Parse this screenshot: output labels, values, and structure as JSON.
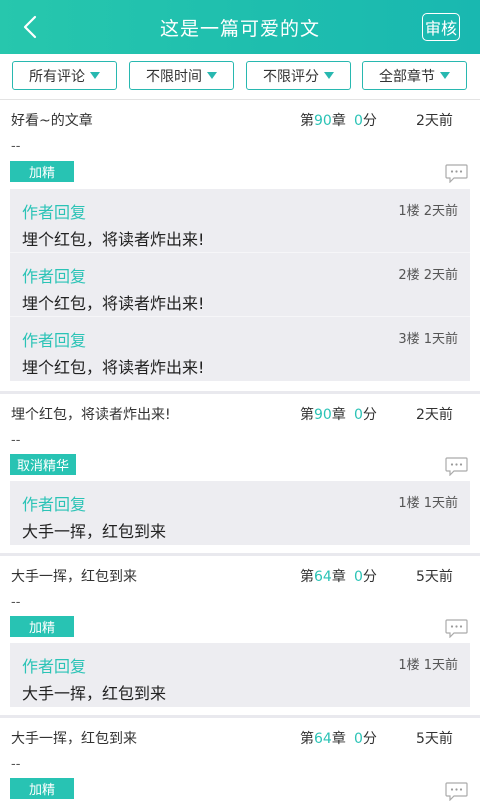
{
  "header": {
    "title": "这是一篇可爱的文",
    "audit_label": "审核"
  },
  "filters": [
    {
      "label": "所有评论"
    },
    {
      "label": "不限时间"
    },
    {
      "label": "不限评分"
    },
    {
      "label": "全部章节"
    }
  ],
  "comments": [
    {
      "text": "好看~的文章",
      "chapter_prefix": "第",
      "chapter": "90",
      "chapter_suffix": "章",
      "score": "0",
      "score_unit": "分",
      "time": "2天前",
      "dash": "--",
      "tag": "加精",
      "replies": [
        {
          "author": "作者回复",
          "meta": "1楼 2天前",
          "text": "埋个红包，将读者炸出来!"
        },
        {
          "author": "作者回复",
          "meta": "2楼 2天前",
          "text": "埋个红包，将读者炸出来!"
        },
        {
          "author": "作者回复",
          "meta": "3楼 1天前",
          "text": "埋个红包，将读者炸出来!"
        }
      ]
    },
    {
      "text": "埋个红包，将读者炸出来!",
      "chapter_prefix": "第",
      "chapter": "90",
      "chapter_suffix": "章",
      "score": "0",
      "score_unit": "分",
      "time": "2天前",
      "dash": "--",
      "tag": "取消精华",
      "replies": [
        {
          "author": "作者回复",
          "meta": "1楼 1天前",
          "text": "大手一挥，红包到来"
        }
      ]
    },
    {
      "text": "大手一挥，红包到来",
      "chapter_prefix": "第",
      "chapter": "64",
      "chapter_suffix": "章",
      "score": "0",
      "score_unit": "分",
      "time": "5天前",
      "dash": "--",
      "tag": "加精",
      "replies": [
        {
          "author": "作者回复",
          "meta": "1楼 1天前",
          "text": "大手一挥，红包到来"
        }
      ]
    },
    {
      "text": "大手一挥，红包到来",
      "chapter_prefix": "第",
      "chapter": "64",
      "chapter_suffix": "章",
      "score": "0",
      "score_unit": "分",
      "time": "5天前",
      "dash": "--",
      "tag": "加精",
      "replies": []
    }
  ],
  "colors": {
    "accent": "#28c3b3",
    "reply_bg": "#ededf1"
  },
  "icons": {
    "back": "chevron-left-icon",
    "comment": "comment-bubble-icon",
    "dropdown": "caret-down-icon"
  }
}
